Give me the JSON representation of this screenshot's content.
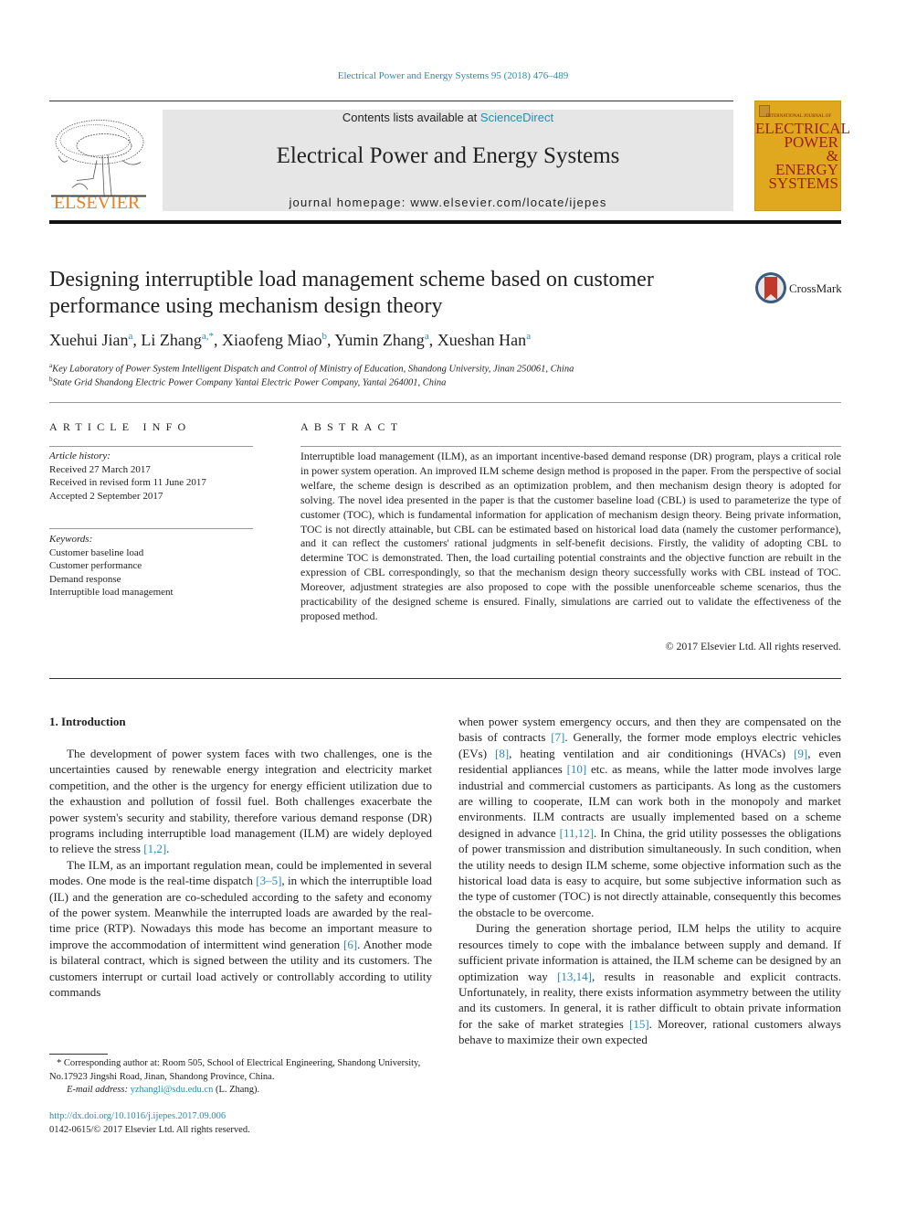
{
  "header": {
    "citation": "Electrical Power and Energy Systems 95 (2018) 476–489",
    "contents_prefix": "Contents lists available at ",
    "contents_link": "ScienceDirect",
    "journal_name": "Electrical Power and Energy Systems",
    "homepage": "journal homepage: www.elsevier.com/locate/ijepes",
    "publisher_logo_text": "ELSEVIER",
    "cover": {
      "line1": "INTERNATIONAL JOURNAL OF",
      "line2": "ELECTRICAL",
      "line3": "POWER",
      "line4": "&",
      "line5": "ENERGY",
      "line6": "SYSTEMS"
    },
    "colors": {
      "link": "#2a8bb3",
      "elsevier_orange": "#f07e1f",
      "cover_bg": "#e0a81e",
      "cover_text": "#9a2015"
    }
  },
  "article": {
    "title": "Designing interruptible load management scheme based on customer performance using mechanism design theory",
    "crossmark_label": "CrossMark",
    "authors": [
      {
        "name": "Xuehui Jian",
        "sup": "a"
      },
      {
        "name": "Li Zhang",
        "sup": "a,*"
      },
      {
        "name": "Xiaofeng Miao",
        "sup": "b"
      },
      {
        "name": "Yumin Zhang",
        "sup": "a"
      },
      {
        "name": "Xueshan Han",
        "sup": "a"
      }
    ],
    "affiliations": [
      {
        "sup": "a",
        "text": "Key Laboratory of Power System Intelligent Dispatch and Control of Ministry of Education, Shandong University, Jinan 250061, China"
      },
      {
        "sup": "b",
        "text": "State Grid Shandong Electric Power Company Yantai Electric Power Company, Yantai 264001, China"
      }
    ]
  },
  "article_info": {
    "heading": "ARTICLE INFO",
    "history_label": "Article history:",
    "history": [
      "Received 27 March 2017",
      "Received in revised form 11 June 2017",
      "Accepted 2 September 2017"
    ],
    "keywords_label": "Keywords:",
    "keywords": [
      "Customer baseline load",
      "Customer performance",
      "Demand response",
      "Interruptible load management"
    ]
  },
  "abstract": {
    "heading": "ABSTRACT",
    "text": "Interruptible load management (ILM), as an important incentive-based demand response (DR) program, plays a critical role in power system operation. An improved ILM scheme design method is proposed in the paper. From the perspective of social welfare, the scheme design is described as an optimization problem, and then mechanism design theory is adopted for solving. The novel idea presented in the paper is that the customer baseline load (CBL) is used to parameterize the type of customer (TOC), which is fundamental information for application of mechanism design theory. Being private information, TOC is not directly attainable, but CBL can be estimated based on historical load data (namely the customer performance), and it can reflect the customers' rational judgments in self-benefit decisions. Firstly, the validity of adopting CBL to determine TOC is demonstrated. Then, the load curtailing potential constraints and the objective function are rebuilt in the expression of CBL correspondingly, so that the mechanism design theory successfully works with CBL instead of TOC. Moreover, adjustment strategies are also proposed to cope with the possible unenforceable scheme scenarios, thus the practicability of the designed scheme is ensured. Finally, simulations are carried out to validate the effectiveness of the proposed method.",
    "copyright": "© 2017 Elsevier Ltd. All rights reserved."
  },
  "body": {
    "section_heading": "1. Introduction",
    "left_paragraphs": [
      [
        {
          "t": "The development of power system faces with two challenges, one is the uncertainties caused by renewable energy integration and electricity market competition, and the other is the urgency for energy efficient utilization due to the exhaustion and pollution of fossil fuel. Both challenges exacerbate the power system's security and stability, therefore various demand response (DR) programs including interruptible load management (ILM) are widely deployed to relieve the stress "
        },
        {
          "ref": "[1,2]"
        },
        {
          "t": "."
        }
      ],
      [
        {
          "t": "The ILM, as an important regulation mean, could be implemented in several modes. One mode is the real-time dispatch "
        },
        {
          "ref": "[3–5]"
        },
        {
          "t": ", in which the interruptible load (IL) and the generation are co-scheduled according to the safety and economy of the power system. Meanwhile the interrupted loads are awarded by the real-time price (RTP). Nowadays this mode has become an important measure to improve the accommodation of intermittent wind generation "
        },
        {
          "ref": "[6]"
        },
        {
          "t": ". Another mode is bilateral contract, which is signed between the utility and its customers. The customers interrupt or curtail load actively or controllably according to utility commands"
        }
      ]
    ],
    "right_paragraphs": [
      [
        {
          "t": "when power system emergency occurs, and then they are compensated on the basis of contracts "
        },
        {
          "ref": "[7]"
        },
        {
          "t": ". Generally, the former mode employs electric vehicles (EVs) "
        },
        {
          "ref": "[8]"
        },
        {
          "t": ", heating ventilation and air conditionings (HVACs) "
        },
        {
          "ref": "[9]"
        },
        {
          "t": ", even residential appliances "
        },
        {
          "ref": "[10]"
        },
        {
          "t": " etc. as means, while the latter mode involves large industrial and commercial customers as participants. As long as the customers are willing to cooperate, ILM can work both in the monopoly and market environments. ILM contracts are usually implemented based on a scheme designed in advance "
        },
        {
          "ref": "[11,12]"
        },
        {
          "t": ". In China, the grid utility possesses the obligations of power transmission and distribution simultaneously. In such condition, when the utility needs to design ILM scheme, some objective information such as the historical load data is easy to acquire, but some subjective information such as the type of customer (TOC) is not directly attainable, consequently this becomes the obstacle to be overcome."
        }
      ],
      [
        {
          "t": "During the generation shortage period, ILM helps the utility to acquire resources timely to cope with the imbalance between supply and demand. If sufficient private information is attained, the ILM scheme can be designed by an optimization way "
        },
        {
          "ref": "[13,14]"
        },
        {
          "t": ", results in reasonable and explicit contracts. Unfortunately, in reality, there exists information asymmetry between the utility and its customers. In general, it is rather difficult to obtain private information for the sake of market strategies "
        },
        {
          "ref": "[15]"
        },
        {
          "t": ". Moreover, rational customers always behave to maximize their own expected"
        }
      ]
    ]
  },
  "footnote": {
    "corresponding": "* Corresponding author at: Room 505, School of Electrical Engineering, Shandong University, No.17923 Jingshi Road, Jinan, Shandong Province, China.",
    "email_label": "E-mail address: ",
    "email": "yzhangli@sdu.edu.cn",
    "email_suffix": " (L. Zhang).",
    "doi": "http://dx.doi.org/10.1016/j.ijepes.2017.09.006",
    "issn": "0142-0615/© 2017 Elsevier Ltd. All rights reserved."
  }
}
